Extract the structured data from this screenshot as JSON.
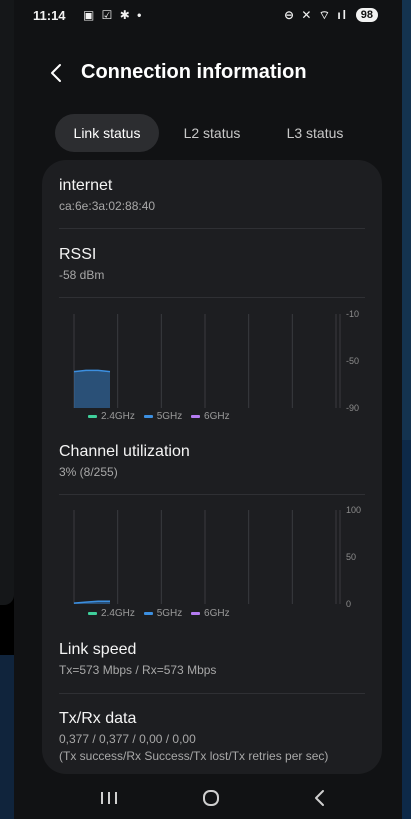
{
  "status_bar": {
    "time": "11:14",
    "battery": "98"
  },
  "header": {
    "title": "Connection information"
  },
  "tabs": [
    {
      "label": "Link status",
      "active": true
    },
    {
      "label": "L2 status",
      "active": false
    },
    {
      "label": "L3 status",
      "active": false
    }
  ],
  "items": {
    "internet": {
      "title": "internet",
      "value": "ca:6e:3a:02:88:40"
    },
    "rssi": {
      "title": "RSSI",
      "value": "-58 dBm"
    },
    "channel": {
      "title": "Channel utilization",
      "value": "3% (8/255)"
    },
    "link_speed": {
      "title": "Link speed",
      "value": "Tx=573 Mbps / Rx=573 Mbps"
    },
    "txrx": {
      "title": "Tx/Rx data",
      "value": "0,377 / 0,377 / 0,00 / 0,00",
      "note": "(Tx success/Rx Success/Tx lost/Tx retries per sec)"
    }
  },
  "legend": {
    "band1": "2.4GHz",
    "band2": "5GHz",
    "band3": "6GHz"
  },
  "colors": {
    "band_2_4": "#3fcf9b",
    "band_5": "#3c8fe0",
    "band_6": "#b57cf2",
    "card": "#1d1e21"
  },
  "chart_data": [
    {
      "type": "area",
      "ylim": [
        -90,
        -10
      ],
      "yticks": [
        "-10",
        "-50",
        "-90"
      ],
      "series": [
        {
          "name": "5GHz",
          "values": [
            -59,
            -58,
            -58,
            -59
          ]
        }
      ]
    },
    {
      "type": "area",
      "ylim": [
        0,
        100
      ],
      "yticks": [
        "100",
        "50",
        "0"
      ],
      "series": [
        {
          "name": "5GHz",
          "values": [
            1,
            2,
            3,
            3
          ]
        }
      ]
    }
  ]
}
